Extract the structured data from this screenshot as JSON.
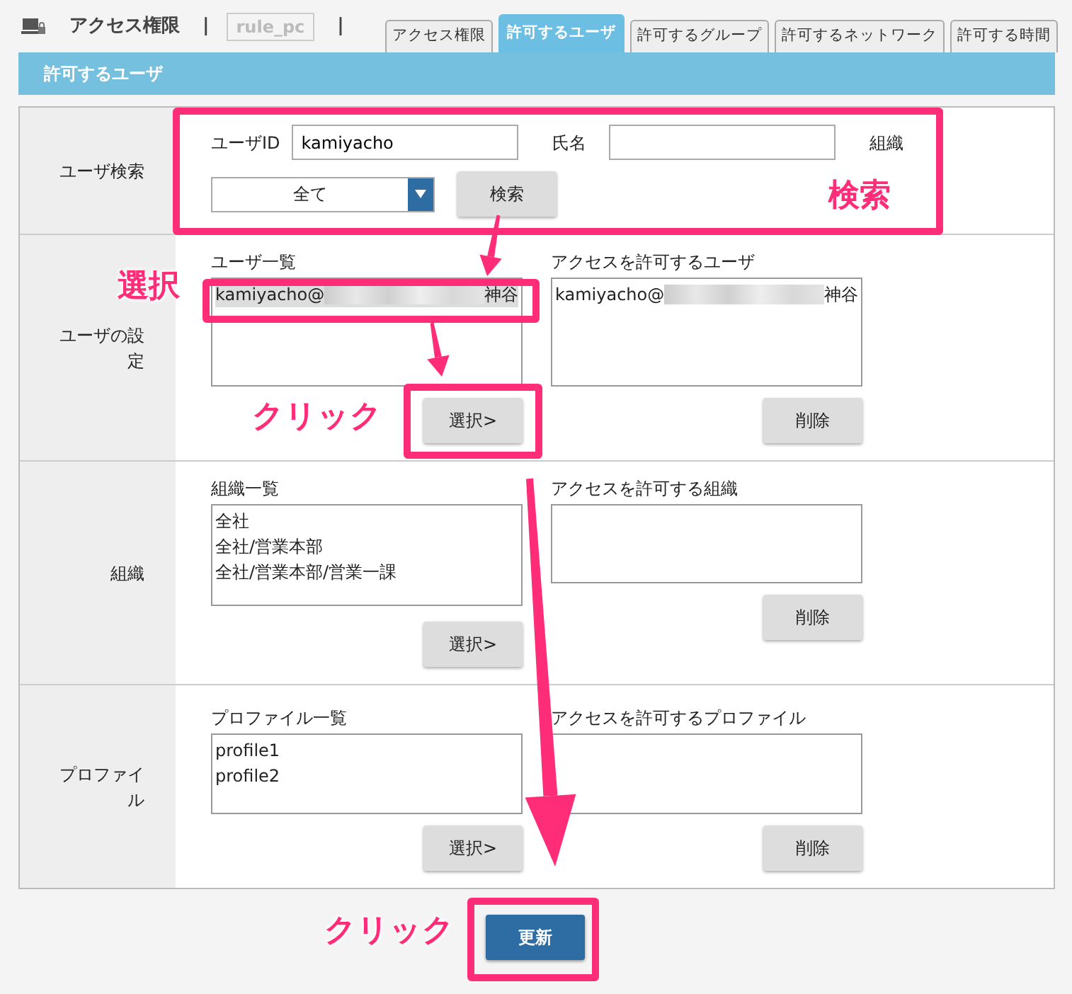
{
  "header": {
    "title": "アクセス権限",
    "separator_1": "|",
    "rule": "rule_pc",
    "separator_2": "|"
  },
  "tabs": [
    {
      "label": "アクセス権限",
      "selected": false
    },
    {
      "label": "許可するユーザ",
      "selected": true
    },
    {
      "label": "許可するグループ",
      "selected": false
    },
    {
      "label": "許可するネットワーク",
      "selected": false
    },
    {
      "label": "許可する時間",
      "selected": false
    }
  ],
  "panel_title": "許可するユーザ",
  "sections": [
    {
      "kind": "search",
      "label": "ユーザ検索",
      "user_id_label": "ユーザID",
      "user_id_value": "kamiyacho",
      "name_label": "氏名",
      "org_label": "組織",
      "org_select": "全て",
      "search_button": "検索"
    },
    {
      "kind": "transfer",
      "label": "ユーザの設定",
      "left_title": "ユーザ一覧",
      "left_items": [
        {
          "prefix": "kamiyacho@",
          "redacted": true,
          "suffix": "神谷",
          "selected": true
        }
      ],
      "select_button": "選択>",
      "right_title": "アクセスを許可するユーザ",
      "right_items": [
        {
          "prefix": "kamiyacho@",
          "redacted": true,
          "suffix": "神谷",
          "selected": false
        }
      ],
      "delete_button": "削除"
    },
    {
      "kind": "transfer",
      "label": "組織",
      "left_title": "組織一覧",
      "left_items": [
        {
          "prefix": "全社",
          "redacted": false,
          "selected": false
        },
        {
          "prefix": "全社/営業本部",
          "redacted": false,
          "selected": false
        },
        {
          "prefix": "全社/営業本部/営業一課",
          "redacted": false,
          "selected": false
        }
      ],
      "select_button": "選択>",
      "right_title": "アクセスを許可する組織",
      "delete_button": "削除"
    },
    {
      "kind": "transfer",
      "label": "プロファイル",
      "left_title": "プロファイル一覧",
      "left_items": [
        {
          "prefix": "profile1",
          "redacted": false,
          "selected": false
        },
        {
          "prefix": "profile2",
          "redacted": false,
          "selected": false
        }
      ],
      "select_button": "選択>",
      "right_title": "アクセスを許可するプロファイル",
      "delete_button": "削除"
    }
  ],
  "update_button": "更新",
  "annotations": [
    {
      "kind": "box"
    },
    {
      "kind": "label",
      "text": "検索"
    },
    {
      "kind": "label",
      "text": "選択"
    },
    {
      "kind": "box"
    },
    {
      "kind": "label",
      "text": "クリック"
    },
    {
      "kind": "box"
    },
    {
      "kind": "label",
      "text": "クリック"
    },
    {
      "kind": "box"
    }
  ]
}
